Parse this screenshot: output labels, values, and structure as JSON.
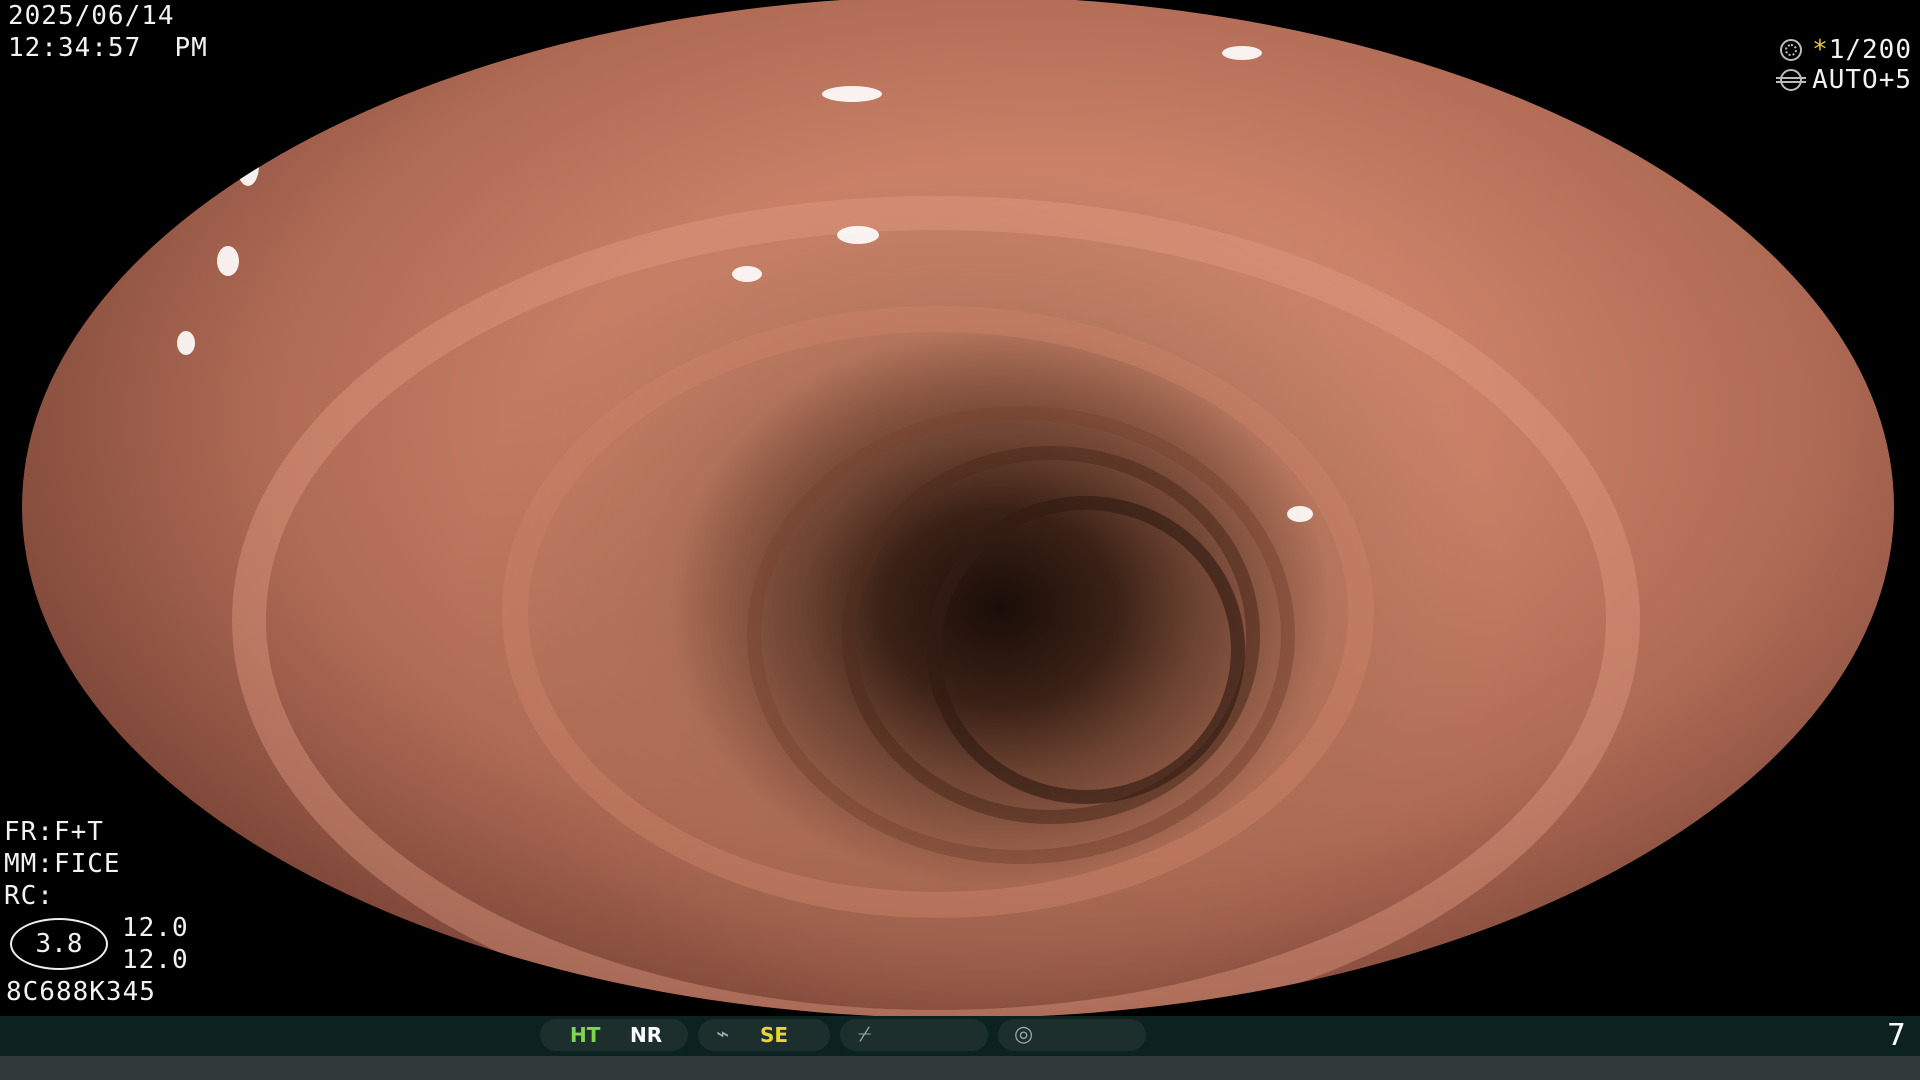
{
  "header": {
    "date": "2025/06/14",
    "time": "12:34:57  PM"
  },
  "camera": {
    "shutter_icon": "shutter-icon",
    "shutter_star": "*",
    "shutter": "1/200",
    "gain_icon": "gain-icon",
    "gain": "AUTO+5"
  },
  "settings": {
    "fr": "FR:F+T",
    "mm": "MM:FICE",
    "rc": "RC:",
    "oval_value": "3.8",
    "rc_value_1": "12.0",
    "rc_value_2": "12.0",
    "serial": "8C688K345"
  },
  "status_bar": {
    "ht": "HT",
    "nr": "NR",
    "se": "SE",
    "se_icon": "scope-edge-icon",
    "slot3_icon": "slash-icon",
    "slot4_icon": "waveform-circle-icon",
    "page_number": "7",
    "colors": {
      "ht": "#7fd64a",
      "se": "#e8d530",
      "bar": "#0c2220"
    }
  }
}
